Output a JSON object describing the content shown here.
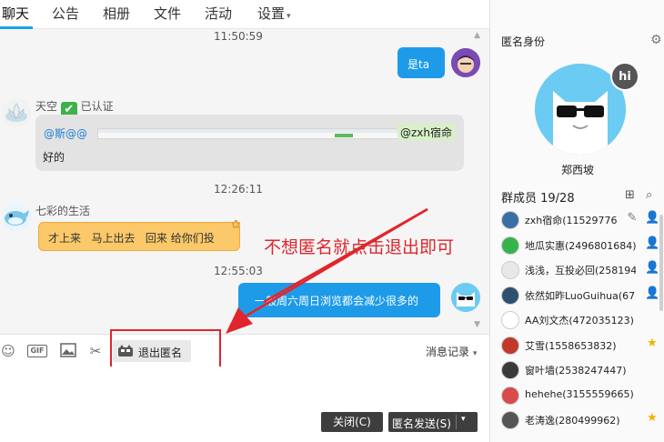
{
  "tabs": [
    {
      "label": "聊天",
      "active": true
    },
    {
      "label": "公告"
    },
    {
      "label": "相册"
    },
    {
      "label": "文件"
    },
    {
      "label": "活动"
    },
    {
      "label": "设置",
      "caret": "▾"
    }
  ],
  "chat": {
    "times": [
      "11:50:59",
      "12:26:11",
      "12:55:03"
    ],
    "msg1": {
      "text": "是ta"
    },
    "msg2": {
      "sender": "天空",
      "verified": "已认证",
      "mention": "@斯@@",
      "quote": "@zxh宿命",
      "text": "好的"
    },
    "msg3": {
      "sender": "七彩的生活",
      "text": "才上来   马上出去   回来 给你们投"
    },
    "msg4": {
      "text": "一般周六周日浏览都会减少很多的"
    }
  },
  "toolbar": {
    "gif": "GIF",
    "exit_anon": "退出匿名",
    "history": "消息记录",
    "history_caret": "▾"
  },
  "footer": {
    "close": "关闭(C)",
    "send": "匿名发送(S)",
    "send_caret": "▾"
  },
  "annotation": "不想匿名就点击退出即可",
  "right": {
    "anon_title": "匿名身份",
    "anon_name": "郑西坡",
    "hi": "hi",
    "members_title": "群成员 19/28",
    "members": [
      {
        "name": "zxh宿命(11529776",
        "color": "#3b6ea5",
        "badge": "✎",
        "badge2": "👤"
      },
      {
        "name": "地瓜实惠(2496801684)",
        "color": "#35b34a",
        "badge": "👤"
      },
      {
        "name": "浅浅，互投必回(258194",
        "color": "#e8e8e8",
        "badge": "👤"
      },
      {
        "name": "依然如昨LuoGuihua(673",
        "color": "#2f4f6f",
        "badge": "👤"
      },
      {
        "name": "AA刘文杰(472035123)",
        "color": "#ffffff",
        "badge": ""
      },
      {
        "name": "艾雪(1558653832)",
        "color": "#c0392b",
        "badge": "★"
      },
      {
        "name": "窗叶墙(2538247447)",
        "color": "#3a3a3a",
        "badge": ""
      },
      {
        "name": "hehehe(3155559665)",
        "color": "#d94a4a",
        "badge": ""
      },
      {
        "name": "老涛逸(280499962)",
        "color": "#555555",
        "badge": "★"
      }
    ]
  }
}
